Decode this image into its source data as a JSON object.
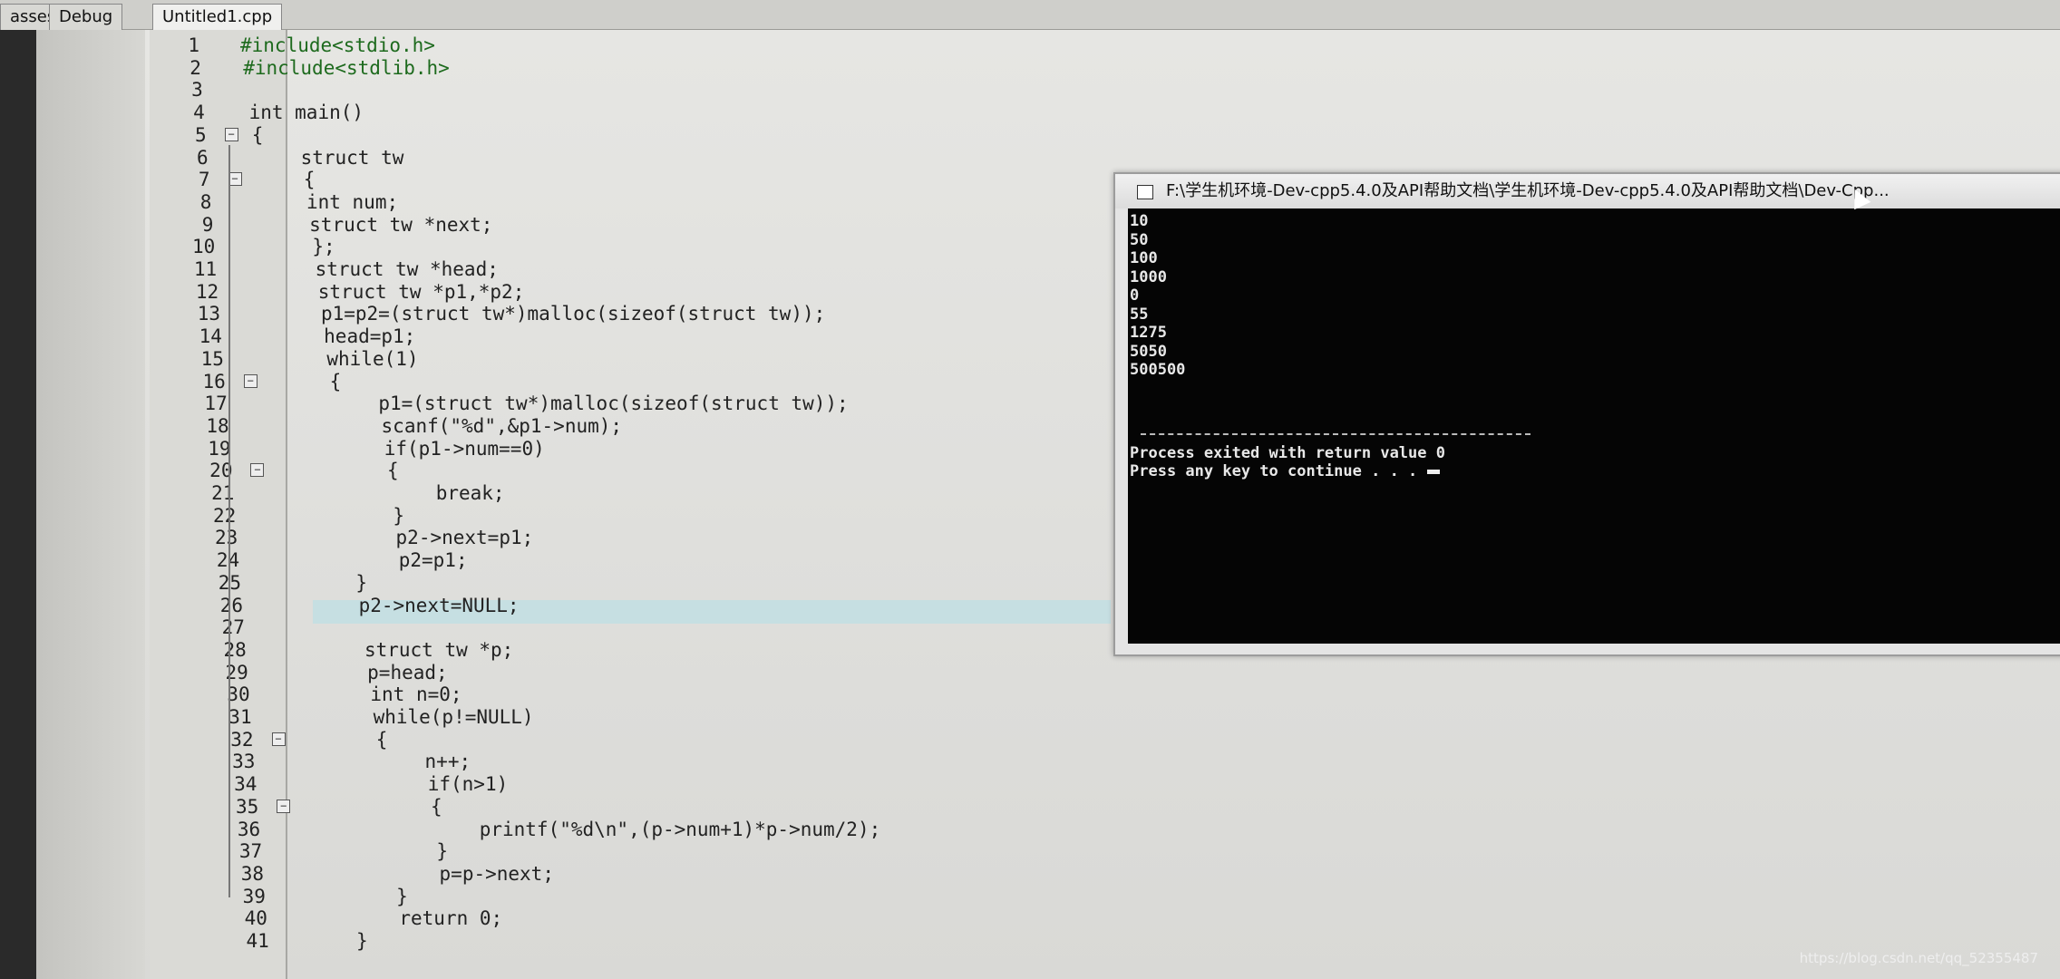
{
  "tabs": [
    "asses",
    "Debug",
    "Untitled1.cpp"
  ],
  "code_lines": [
    "#include<stdio.h>",
    "#include<stdlib.h>",
    "",
    "int main()",
    "{",
    "    struct tw",
    "    {",
    "    int num;",
    "    struct tw *next;",
    "    };",
    "    struct tw *head;",
    "    struct tw *p1,*p2;",
    "    p1=p2=(struct tw*)malloc(sizeof(struct tw));",
    "    head=p1;",
    "    while(1)",
    "    {",
    "        p1=(struct tw*)malloc(sizeof(struct tw));",
    "        scanf(\"%d\",&p1->num);",
    "        if(p1->num==0)",
    "        {",
    "            break;",
    "        }",
    "        p2->next=p1;",
    "        p2=p1;",
    "    }",
    "    p2->next=NULL;",
    "",
    "    struct tw *p;",
    "    p=head;",
    "    int n=0;",
    "    while(p!=NULL)",
    "    {",
    "        n++;",
    "        if(n>1)",
    "        {",
    "            printf(\"%d\\n\",(p->num+1)*p->num/2);",
    "        }",
    "        p=p->next;",
    "    }",
    "    return 0;",
    "}"
  ],
  "console": {
    "title": "F:\\学生机环境-Dev-cpp5.4.0及API帮助文档\\学生机环境-Dev-cpp5.4.0及API帮助文档\\Dev-Cpp...",
    "output": [
      "10",
      "50",
      "100",
      "1000",
      "0",
      "55",
      "1275",
      "5050",
      "500500"
    ],
    "exit_msg": "Process exited with return value 0",
    "continue_msg": "Press any key to continue . . ."
  },
  "watermark": "https://blog.csdn.net/qq_52355487"
}
